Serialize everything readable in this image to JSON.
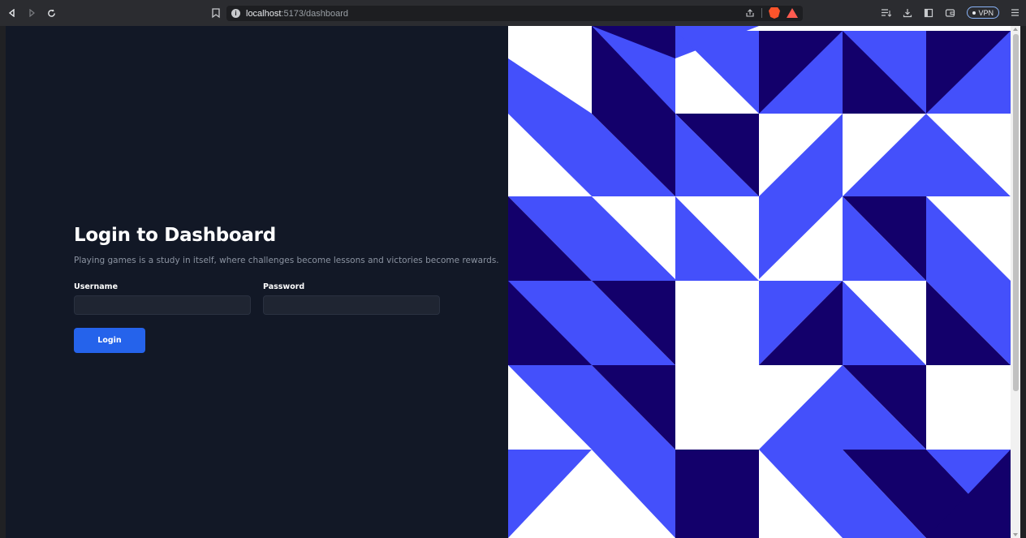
{
  "browser": {
    "url_host": "localhost",
    "url_path": ":5173/dashboard",
    "vpn_label": "VPN",
    "icons": [
      "back-icon",
      "forward-icon",
      "reload-icon",
      "bookmark-icon",
      "site-info-icon",
      "share-icon",
      "brave-shields-icon",
      "brave-rewards-icon",
      "playlist-icon",
      "download-icon",
      "sidebar-icon",
      "wallet-icon",
      "menu-icon"
    ]
  },
  "login": {
    "title": "Login to Dashboard",
    "subtitle": "Playing games is a study in itself, where challenges become lessons and victories become rewards.",
    "username_label": "Username",
    "password_label": "Password",
    "username_value": "",
    "password_value": "",
    "button_label": "Login"
  },
  "colors": {
    "background": "#121826",
    "input_bg": "#1f2532",
    "accent": "#2563eb",
    "pattern_blue": "#4450fb",
    "pattern_navy": "#13006b",
    "pattern_white": "#ffffff"
  }
}
